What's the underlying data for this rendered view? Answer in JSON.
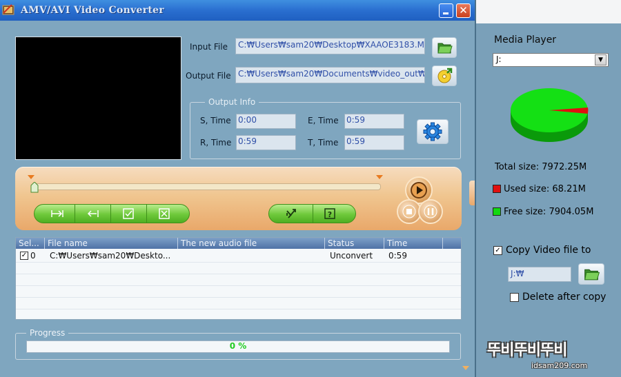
{
  "window": {
    "title": "AMV/AVI Video Converter",
    "close_glyph": "✕"
  },
  "files": {
    "input_label": "Input File",
    "input_value": "C:₩Users₩sam20₩Desktop₩XAAOE3183.M(",
    "output_label": "Output File",
    "output_value": "C:₩Users₩sam20₩Documents₩video_out₩"
  },
  "output_info": {
    "title": "Output Info",
    "s_time_label": "S, Time",
    "s_time_value": "0:00",
    "e_time_label": "E, Time",
    "e_time_value": "0:59",
    "r_time_label": "R, Time",
    "r_time_value": "0:59",
    "t_time_label": "T, Time",
    "t_time_value": "0:59"
  },
  "table": {
    "headers": [
      "Sel...",
      "File name",
      "The new audio file",
      "Status",
      "Time"
    ],
    "rows": [
      {
        "sel": "0",
        "file_name": "C:₩Users₩sam20₩Deskto...",
        "new_audio": "",
        "status": "Unconvert",
        "time": "0:59"
      }
    ]
  },
  "progress": {
    "title": "Progress",
    "value_text": "0 %",
    "fraction": 0
  },
  "media_player": {
    "title": "Media Player",
    "drive": "J:",
    "total_size": "Total size: 7972.25M",
    "used_size": "Used size: 68.21M",
    "free_size": "Free size: 7904.05M",
    "used_color": "#e01010",
    "free_color": "#12d812",
    "copy_label": "Copy Video file to",
    "copy_checked": true,
    "copy_path": "J:₩",
    "delete_label": "Delete after copy",
    "delete_checked": false
  },
  "watermark": {
    "text": "뚜비뚜비뚜비",
    "url": "idsam209.com"
  },
  "icons": [
    "app-icon",
    "minimize-icon",
    "close-icon",
    "folder-open-icon",
    "disc-save-icon",
    "gear-icon",
    "play-icon",
    "stop-icon",
    "pause-icon",
    "mark-in-icon",
    "mark-out-icon",
    "check-icon",
    "uncheck-icon",
    "convert-icon",
    "help-icon"
  ]
}
